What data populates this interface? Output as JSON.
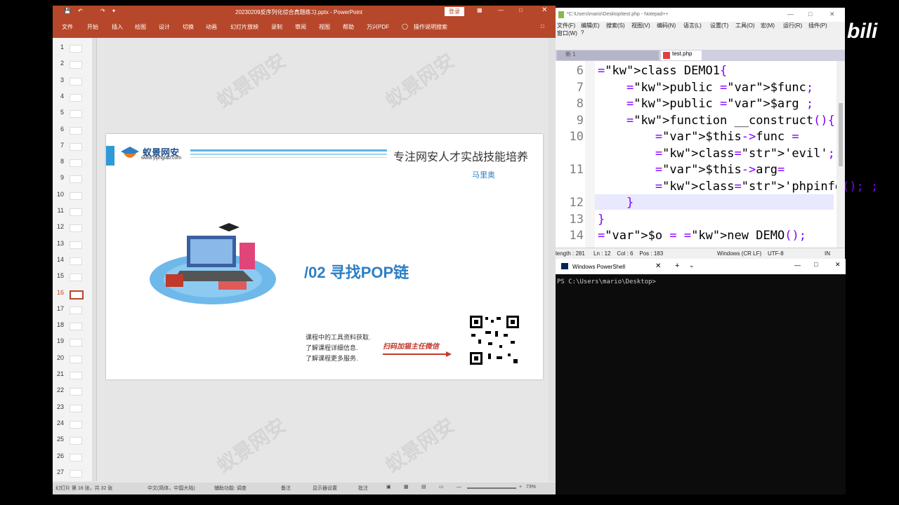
{
  "ppt": {
    "title": "20230209反序列化综合真题练习.pptx - PowerPoint",
    "login": "登录",
    "tabs": [
      "文件",
      "开始",
      "插入",
      "绘图",
      "设计",
      "切换",
      "动画",
      "幻灯片放映",
      "录制",
      "审阅",
      "视图",
      "帮助",
      "万兴PDF"
    ],
    "tell_me": "操作说明搜索",
    "slide_numbers": [
      "1",
      "2",
      "3",
      "4",
      "5",
      "6",
      "7",
      "8",
      "9",
      "10",
      "11",
      "12",
      "13",
      "14",
      "15",
      "16",
      "17",
      "18",
      "19",
      "20",
      "21",
      "22",
      "23",
      "24",
      "25",
      "26",
      "27"
    ],
    "selected_slide": "16",
    "status": {
      "slide_info": "幻灯片 第 16 张，共 32 张",
      "lang": "中文(简体，中国大陆)",
      "accessibility": "辅助功能: 调查",
      "notes": "备注",
      "display": "显示器设置",
      "comments": "批注",
      "zoom": "73%"
    }
  },
  "slide": {
    "brand_name": "蚁景网安",
    "brand_url": "www.yijinglab.com",
    "tagline": "专注网安人才实战技能培养",
    "presenter": "马里奥",
    "heading": "/02 寻找POP链",
    "info_lines": [
      "课程中的工具资料获取.",
      "了解课程详细信息.",
      "了解课程更多服务."
    ],
    "scan_text": "扫码加猫主任微信"
  },
  "npp": {
    "title": "*C:\\Users\\mario\\Desktop\\test.php - Notepad++",
    "menu": [
      "文件(F)",
      "编辑(E)",
      "搜索(S)",
      "视图(V)",
      "编码(N)",
      "语言(L)",
      "设置(T)",
      "工具(O)",
      "宏(M)",
      "运行(R)",
      "插件(P)",
      "窗口(W)",
      "?"
    ],
    "tabs": [
      "新 1",
      "test.php"
    ],
    "lines": [
      {
        "n": "6",
        "text": "class DEMO1{"
      },
      {
        "n": "7",
        "text": "    public $func;"
      },
      {
        "n": "8",
        "text": "    public $arg ;"
      },
      {
        "n": "9",
        "text": "    function __construct(){"
      },
      {
        "n": "10",
        "text": "        $this->func ="
      },
      {
        "n": "",
        "text": "        'evil';"
      },
      {
        "n": "11",
        "text": "        $this->arg="
      },
      {
        "n": "",
        "text": "        'phpinfo();';"
      },
      {
        "n": "12",
        "text": "    }"
      },
      {
        "n": "13",
        "text": "}"
      },
      {
        "n": "14",
        "text": "$o = new DEMO();"
      }
    ],
    "status": {
      "length": "length : 281",
      "pos": "Ln : 12    Col : 6    Pos : 183",
      "eol": "Windows (CR LF)",
      "encoding": "UTF-8",
      "mode": "IN"
    }
  },
  "ps": {
    "title": "Windows PowerShell",
    "prompt": "PS C:\\Users\\mario\\Desktop>"
  },
  "overlay": {
    "bili": "bili"
  }
}
